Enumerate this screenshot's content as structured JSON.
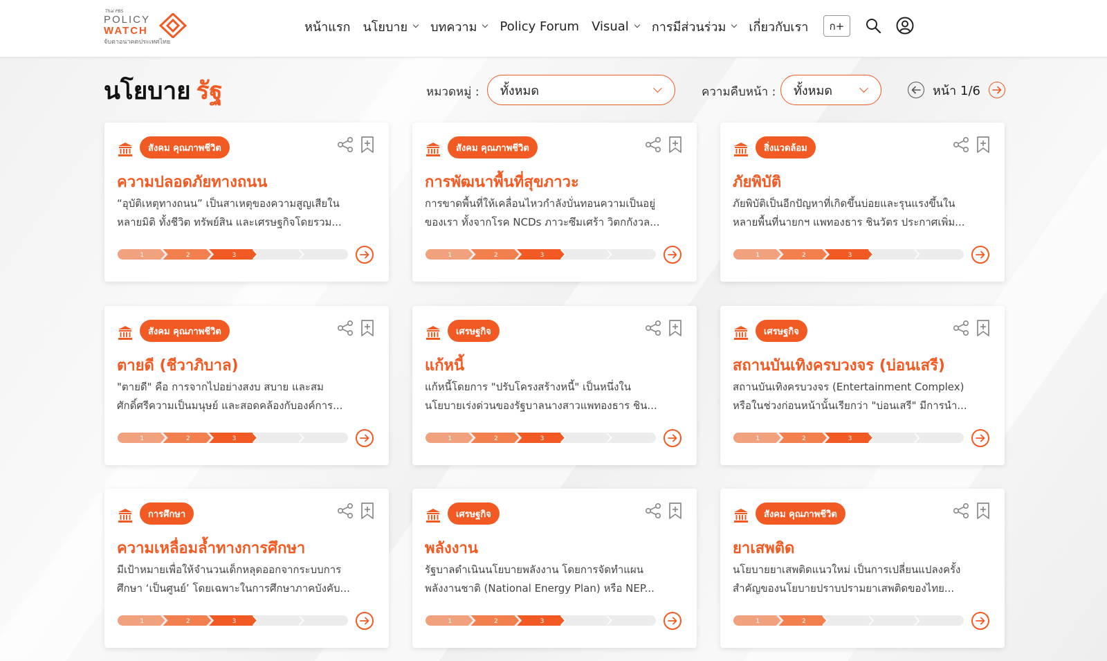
{
  "header": {
    "logo": {
      "small": "Thai PBS",
      "line1": "POLICY",
      "line2": "WATCH",
      "tagline": "จับตาอนาคตประเทศไทย"
    },
    "nav": [
      {
        "label": "หน้าแรก",
        "dropdown": false
      },
      {
        "label": "นโยบาย",
        "dropdown": true
      },
      {
        "label": "บทความ",
        "dropdown": true
      },
      {
        "label": "Policy Forum",
        "dropdown": false
      },
      {
        "label": "Visual",
        "dropdown": true
      },
      {
        "label": "การมีส่วนร่วม",
        "dropdown": true
      },
      {
        "label": "เกี่ยวกับเรา",
        "dropdown": false
      }
    ],
    "lang_button": "ก+",
    "icons": [
      "search-icon",
      "user-account-icon"
    ]
  },
  "page": {
    "title": "นโยบาย",
    "title_accent": "รัฐ"
  },
  "filters": {
    "category_label": "หมวดหมู่ :",
    "category_value": "ทั้งหมด",
    "progress_label": "ความคืบหน้า :",
    "progress_value": "ทั้งหมด"
  },
  "pagination": {
    "text": "หน้า 1/6"
  },
  "colors": {
    "accent": "#f15a22",
    "progress_1": "#f2a17e",
    "progress_2": "#f2804f",
    "progress_3": "#f15a22",
    "progress_empty": "#ececec"
  },
  "cards": [
    {
      "tag": "สังคม คุณภาพชีวิต",
      "title": "ความปลอดภัยทางถนน",
      "desc_line1": "“อุบัติเหตุทางถนน” เป็นสาเหตุของความสูญเสียใน",
      "desc_line2": "หลายมิติ ทั้งชีวิต ทรัพย์สิน และเศรษฐกิจโดยรวม...",
      "stage": 3,
      "stage_labels": [
        "1",
        "2",
        "3"
      ]
    },
    {
      "tag": "สังคม คุณภาพชีวิต",
      "title": "การพัฒนาพื้นที่สุขภาวะ",
      "desc_line1": "การขาดพื้นที่ให้เคลื่อนไหวกำลังบั่นทอนความเป็นอยู่",
      "desc_line2": "ของเรา ทั้งจากโรค NCDs ภาวะซึมเศร้า วิตกกังวล...",
      "stage": 3,
      "stage_labels": [
        "1",
        "2",
        "3"
      ]
    },
    {
      "tag": "สิ่งแวดล้อม",
      "title": "ภัยพิบัติ",
      "desc_line1": "ภัยพิบัติเป็นอีกปัญหาที่เกิดขึ้นบ่อยและรุนแรงขึ้นใน",
      "desc_line2": "หลายพื้นที่นายกฯ แพทองธาร ชินวัตร ประกาศเพิ่ม...",
      "stage": 3,
      "stage_labels": [
        "1",
        "2",
        "3"
      ]
    },
    {
      "tag": "สังคม คุณภาพชีวิต",
      "title": "ตายดี (ชีวาภิบาล)",
      "desc_line1": "\"ตายดี\" คือ การจากไปอย่างสงบ สบาย และสม",
      "desc_line2": "ศักดิ์ศรีความเป็นมนุษย์ และสอดคล้องกับองค์การ...",
      "stage": 3,
      "stage_labels": [
        "1",
        "2",
        "3"
      ]
    },
    {
      "tag": "เศรษฐกิจ",
      "title": "แก้หนี้",
      "desc_line1": "แก้หนี้โดยการ \"ปรับโครงสร้างหนี้\" เป็นหนึ่งใน",
      "desc_line2": "นโยบายเร่งด่วนของรัฐบาลนางสาวแพทองธาร ชิน...",
      "stage": 3,
      "stage_labels": [
        "1",
        "2",
        "3"
      ]
    },
    {
      "tag": "เศรษฐกิจ",
      "title": "สถานบันเทิงครบวงจร (บ่อนเสรี)",
      "desc_line1": "สถานบันเทิงครบวงจร (Entertainment Complex)",
      "desc_line2": "หรือในช่วงก่อนหน้านั้นเรียกว่า \"บ่อนเสรี\" มีการนำ...",
      "stage": 3,
      "stage_labels": [
        "1",
        "2",
        "3"
      ]
    },
    {
      "tag": "การศึกษา",
      "title": "ความเหลื่อมล้ำทางการศึกษา",
      "desc_line1": "มีเป้าหมายเพื่อให้จำนวนเด็กหลุดออกจากระบบการ",
      "desc_line2": "ศึกษา ‘เป็นศูนย์’ โดยเฉพาะในการศึกษาภาคบังคับ...",
      "stage": 3,
      "stage_labels": [
        "1",
        "2",
        "3"
      ]
    },
    {
      "tag": "เศรษฐกิจ",
      "title": "พลังงาน",
      "desc_line1": "รัฐบาลดำเนินนโยบายพลังงาน โดยการจัดทำแผน",
      "desc_line2": "พลังงานชาติ (National Energy Plan) หรือ NEP...",
      "stage": 3,
      "stage_labels": [
        "1",
        "2",
        "3"
      ]
    },
    {
      "tag": "สังคม คุณภาพชีวิต",
      "title": "ยาเสพติด",
      "desc_line1": "นโยบายยาเสพติดแนวใหม่ เป็นการเปลี่ยนแปลงครั้ง",
      "desc_line2": "สำคัญของนโยบายปราบปรามยาเสพติดของไทย...",
      "stage": 2,
      "stage_labels": [
        "1",
        "2"
      ]
    }
  ]
}
